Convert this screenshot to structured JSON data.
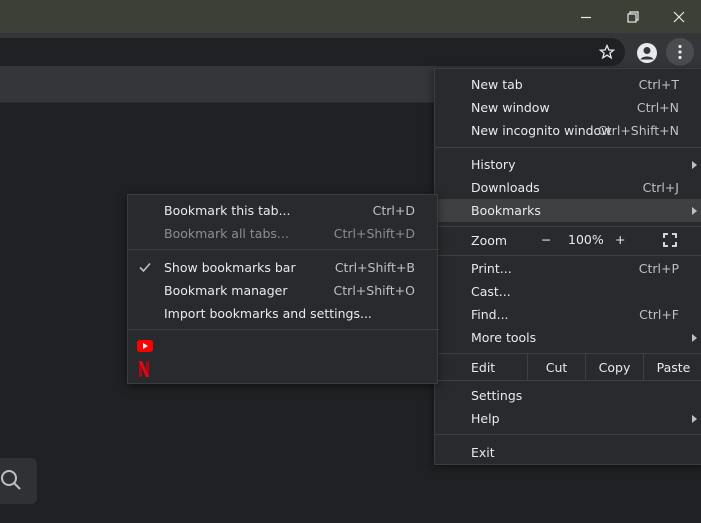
{
  "colors": {
    "titlebar": "#3c4035",
    "toolbar": "#35363a",
    "menu_bg": "#292a2d",
    "highlight": "#3f4042",
    "youtube_red": "#ff0000",
    "netflix_red": "#e50914"
  },
  "window_controls": [
    {
      "name": "minimize-icon"
    },
    {
      "name": "restore-icon"
    },
    {
      "name": "close-icon"
    }
  ],
  "main_menu": {
    "new_tab": {
      "label": "New tab",
      "shortcut": "Ctrl+T"
    },
    "new_window": {
      "label": "New window",
      "shortcut": "Ctrl+N"
    },
    "new_incognito": {
      "label": "New incognito window",
      "shortcut": "Ctrl+Shift+N"
    },
    "history": {
      "label": "History"
    },
    "downloads": {
      "label": "Downloads",
      "shortcut": "Ctrl+J"
    },
    "bookmarks": {
      "label": "Bookmarks"
    },
    "zoom": {
      "label": "Zoom",
      "minus": "−",
      "value": "100%",
      "plus": "+"
    },
    "print": {
      "label": "Print...",
      "shortcut": "Ctrl+P"
    },
    "cast": {
      "label": "Cast..."
    },
    "find": {
      "label": "Find...",
      "shortcut": "Ctrl+F"
    },
    "more_tools": {
      "label": "More tools"
    },
    "edit": {
      "label": "Edit",
      "cut": "Cut",
      "copy": "Copy",
      "paste": "Paste"
    },
    "settings": {
      "label": "Settings"
    },
    "help": {
      "label": "Help"
    },
    "exit": {
      "label": "Exit"
    }
  },
  "bookmarks_menu": {
    "bookmark_tab": {
      "label": "Bookmark this tab...",
      "shortcut": "Ctrl+D"
    },
    "bookmark_all": {
      "label": "Bookmark all tabs...",
      "shortcut": "Ctrl+Shift+D"
    },
    "show_bar": {
      "label": "Show bookmarks bar",
      "shortcut": "Ctrl+Shift+B",
      "checked": true
    },
    "manager": {
      "label": "Bookmark manager",
      "shortcut": "Ctrl+Shift+O"
    },
    "import": {
      "label": "Import bookmarks and settings..."
    },
    "favorites": [
      {
        "name": "youtube-favicon"
      },
      {
        "name": "netflix-favicon"
      }
    ]
  }
}
